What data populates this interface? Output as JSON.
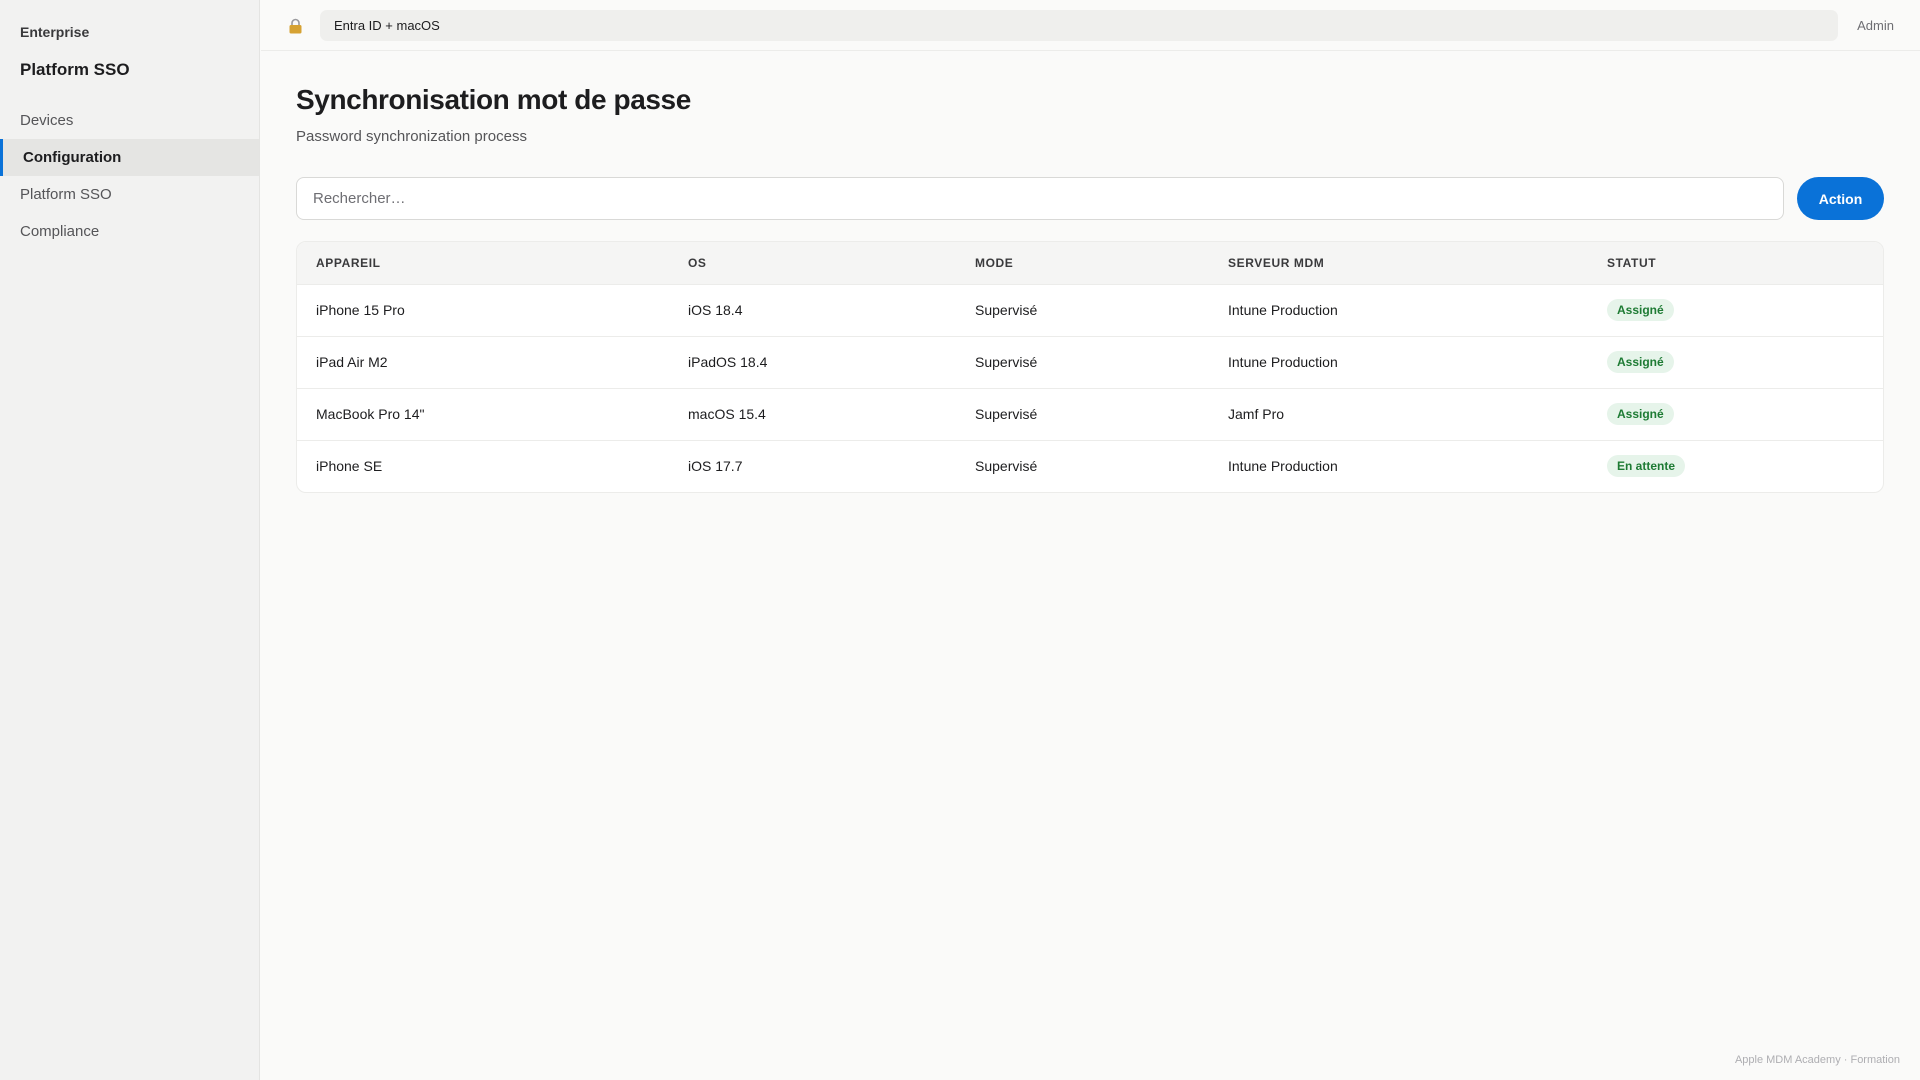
{
  "sidebar": {
    "eyebrow": "Enterprise",
    "title": "Platform SSO",
    "items": [
      {
        "label": "Devices",
        "active": false
      },
      {
        "label": "Configuration",
        "active": true
      },
      {
        "label": "Platform SSO",
        "active": false
      },
      {
        "label": "Compliance",
        "active": false
      }
    ]
  },
  "topbar": {
    "lock_icon": "lock-icon",
    "environment": "Entra ID + macOS",
    "user": "Admin"
  },
  "main": {
    "title": "Synchronisation mot de passe",
    "subtitle": "Password synchronization process",
    "search": {
      "placeholder": "Rechercher…",
      "value": ""
    },
    "action_label": "Action"
  },
  "table": {
    "columns": [
      "APPAREIL",
      "OS",
      "MODE",
      "SERVEUR MDM",
      "STATUT"
    ],
    "rows": [
      {
        "device": "iPhone 15 Pro",
        "os": "iOS 18.4",
        "mode": "Supervisé",
        "server": "Intune Production",
        "status": "Assigné"
      },
      {
        "device": "iPad Air M2",
        "os": "iPadOS 18.4",
        "mode": "Supervisé",
        "server": "Intune Production",
        "status": "Assigné"
      },
      {
        "device": "MacBook Pro 14\"",
        "os": "macOS 15.4",
        "mode": "Supervisé",
        "server": "Jamf Pro",
        "status": "Assigné"
      },
      {
        "device": "iPhone SE",
        "os": "iOS 17.7",
        "mode": "Supervisé",
        "server": "Intune Production",
        "status": "En attente"
      }
    ]
  },
  "footer": {
    "note": "Apple MDM Academy · Formation"
  },
  "colors": {
    "accent": "#0a72d8",
    "badge_bg": "#e6f4ea",
    "badge_text": "#1e7b34"
  }
}
